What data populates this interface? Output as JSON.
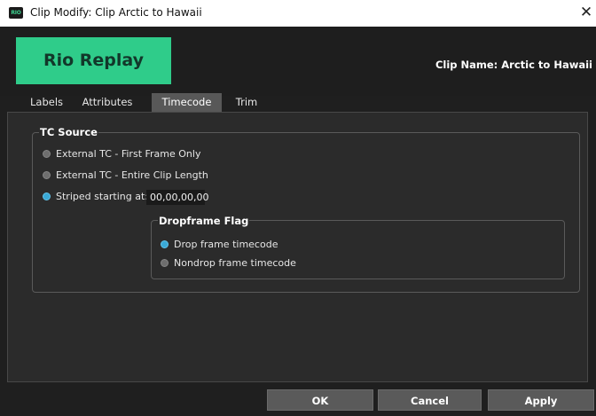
{
  "window": {
    "title": "Clip Modify: Clip Arctic to Hawaii",
    "app_icon_text": "RIO",
    "close_glyph": "✕"
  },
  "header": {
    "logo_text": "Rio Replay",
    "clip_name": "Clip Name: Arctic to Hawaii"
  },
  "tabs": [
    {
      "label": "Labels",
      "active": false
    },
    {
      "label": "Attributes",
      "active": false
    },
    {
      "label": "Timecode",
      "active": true
    },
    {
      "label": "Trim",
      "active": false
    }
  ],
  "tc_source": {
    "legend": "TC Source",
    "options": [
      {
        "label": "External TC - First Frame Only",
        "selected": false
      },
      {
        "label": "External TC - Entire Clip Length",
        "selected": false
      },
      {
        "label": "Striped starting at:",
        "selected": true
      }
    ],
    "start_value": "00,00,00,00"
  },
  "dropframe": {
    "legend": "Dropframe Flag",
    "options": [
      {
        "label": "Drop frame timecode",
        "selected": true
      },
      {
        "label": "Nondrop frame timecode",
        "selected": false
      }
    ]
  },
  "buttons": {
    "ok": "OK",
    "cancel": "Cancel",
    "apply": "Apply"
  },
  "colors": {
    "accent_green": "#2fcc8a",
    "radio_selected": "#3aa9d6",
    "background": "#1f1f1f",
    "panel": "#2b2b2b"
  }
}
